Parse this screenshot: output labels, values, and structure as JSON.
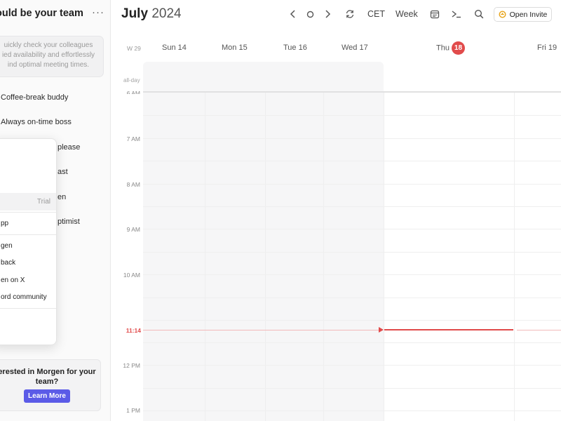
{
  "sidebar": {
    "title": "ould be your team",
    "more_label": "···",
    "info_text": "uickly check your colleagues ied availability and effortlessly ind optimal meeting times.",
    "items": [
      {
        "label": "Coffee-break buddy"
      },
      {
        "label": "Always on-time boss"
      },
      {
        "label": "please"
      },
      {
        "label": "ast"
      },
      {
        "label": "en"
      },
      {
        "label": "ptimist"
      }
    ],
    "promo": {
      "line1": "erested in Morgen for your",
      "line2": "team?",
      "button_label": "Learn More"
    }
  },
  "menu": {
    "trial_label": "Trial",
    "items": [
      {
        "label": "pp"
      },
      {
        "label": "gen"
      },
      {
        "label": "back"
      },
      {
        "label": "en on X"
      },
      {
        "label": "ord community"
      }
    ]
  },
  "header": {
    "month": "July",
    "year": "2024",
    "timezone_label": "CET",
    "view_label": "Week",
    "invite_label": "Open Invite"
  },
  "days": {
    "week_number": "W 29",
    "names": [
      "Sun 14",
      "Mon 15",
      "Tue 16",
      "Wed 17",
      "Thu",
      "Fri 19"
    ],
    "today_number": "18"
  },
  "grid": {
    "allday_label": "all-day",
    "time_labels": [
      "6 AM",
      "7 AM",
      "8 AM",
      "9 AM",
      "10 AM",
      "12 PM",
      "1 PM"
    ],
    "now_label": "11:14"
  },
  "colors": {
    "accent": "#5b5be7",
    "today": "#e14b4b",
    "invite_icon": "#e7a317"
  }
}
